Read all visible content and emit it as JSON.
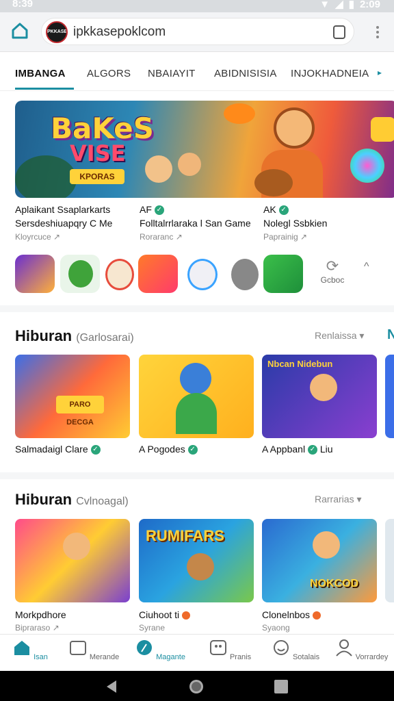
{
  "status_bar": {
    "time_left": "8:39",
    "time_right": "2:09"
  },
  "browser": {
    "url": "ipkkasepoklcom",
    "favicon_text": "PKKASE"
  },
  "tabs": {
    "items": [
      "IMBANGA",
      "ALGORS",
      "NBAIAYIT",
      "ABIDNISISIA",
      "INJOKHADNEIA"
    ],
    "active_index": 0
  },
  "featured": [
    {
      "title": "Aplaikant Ssaplarkarts",
      "subtitle": "Sersdeshiuapqry C Me",
      "meta": "Kloyrcuce"
    },
    {
      "title": "AF",
      "subtitle": "Folltalrrlaraka l San Game",
      "meta": "Roraranc"
    },
    {
      "title": "AK",
      "subtitle": "Nolegl Ssbkien",
      "meta": "Paprainig"
    }
  ],
  "hero": {
    "logo": "BaKeS",
    "line2": "VISE",
    "plate": "KPORAS"
  },
  "cycle_label": "Gcboc",
  "sections": [
    {
      "title": "Hiburan",
      "subtitle": "(Garlosarai)",
      "more": "Renlaissa",
      "cards": [
        {
          "label": "Salmadaigl Clare",
          "sub": ""
        },
        {
          "label": "A Pogodes",
          "sub": ""
        },
        {
          "label": "A Appbanl",
          "sub": "",
          "extra": "Liu"
        }
      ]
    },
    {
      "title": "Hiburan",
      "subtitle": "Cvlnoagal)",
      "more": "Rarrarias",
      "cards": [
        {
          "label": "Morkpdhore",
          "sub": "Bipraraso"
        },
        {
          "label": "Ciuhoot ti",
          "sub": "Syrane"
        },
        {
          "label": "Clonelnbos",
          "sub": "Syaong"
        }
      ]
    }
  ],
  "section1_card3_title": "Nbcan Nidebun",
  "section2_card2_title": "RUMIFARS",
  "section2_card3_title": "NOKCOD",
  "section1_card1_plate": "PARO DECGA",
  "bottom_nav": [
    {
      "label": "Isan",
      "icon": "home-icon"
    },
    {
      "label": "Merande",
      "icon": "library-icon"
    },
    {
      "label": "Magante",
      "icon": "compass-icon"
    },
    {
      "label": "Pranis",
      "icon": "games-icon"
    },
    {
      "label": "Sotalais",
      "icon": "smile-icon"
    },
    {
      "label": "Vorrardey",
      "icon": "person-icon"
    }
  ],
  "colors": {
    "accent": "#1b8ea1",
    "check": "#2aa57a"
  }
}
